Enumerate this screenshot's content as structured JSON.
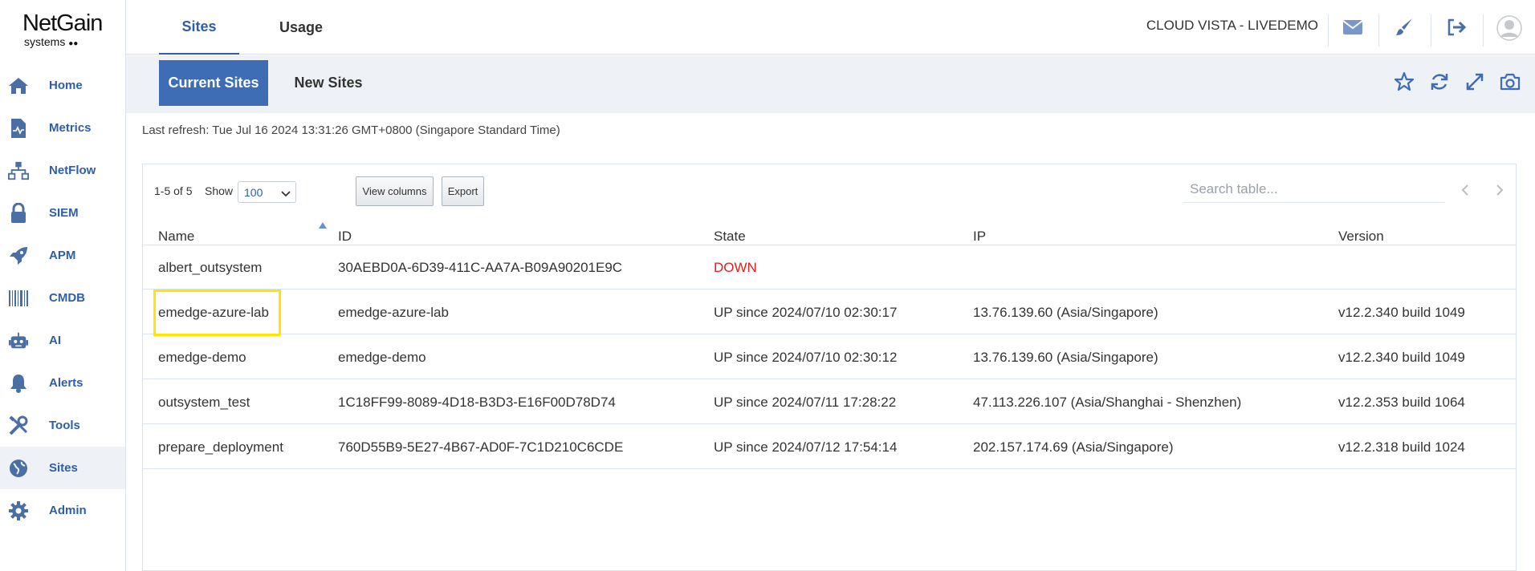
{
  "logo": {
    "main": "NetGain",
    "sub": "systems"
  },
  "sidebar": {
    "items": [
      {
        "label": "Home",
        "icon": "home-icon"
      },
      {
        "label": "Metrics",
        "icon": "metrics-icon"
      },
      {
        "label": "NetFlow",
        "icon": "netflow-icon"
      },
      {
        "label": "SIEM",
        "icon": "lock-icon"
      },
      {
        "label": "APM",
        "icon": "rocket-icon"
      },
      {
        "label": "CMDB",
        "icon": "barcode-icon"
      },
      {
        "label": "AI",
        "icon": "robot-icon"
      },
      {
        "label": "Alerts",
        "icon": "bell-icon"
      },
      {
        "label": "Tools",
        "icon": "tools-icon"
      },
      {
        "label": "Sites",
        "icon": "globe-icon"
      },
      {
        "label": "Admin",
        "icon": "gear-icon"
      }
    ],
    "active": "Sites"
  },
  "topbar": {
    "tabs": [
      {
        "label": "Sites"
      },
      {
        "label": "Usage"
      }
    ],
    "env_name": "CLOUD VISTA - LIVEDEMO",
    "icons": [
      "mail-icon",
      "brush-icon",
      "logout-icon",
      "user-avatar-icon"
    ]
  },
  "subbar": {
    "tabs": [
      {
        "label": "Current Sites"
      },
      {
        "label": "New Sites"
      }
    ],
    "icons": [
      "star-icon",
      "refresh-icon",
      "expand-icon",
      "camera-icon"
    ]
  },
  "refresh_text": "Last refresh: Tue Jul 16 2024 13:31:26 GMT+0800 (Singapore Standard Time)",
  "table": {
    "count_text": "1-5 of 5",
    "show_label": "Show",
    "show_value": "100",
    "view_columns_label": "View columns",
    "export_label": "Export",
    "search_placeholder": "Search table...",
    "columns": [
      "Name",
      "ID",
      "State",
      "IP",
      "Version"
    ],
    "rows": [
      {
        "name": "albert_outsystem",
        "id": "30AEBD0A-6D39-411C-AA7A-B09A90201E9C",
        "state": "DOWN",
        "ip": "",
        "version": ""
      },
      {
        "name": "emedge-azure-lab",
        "id": "emedge-azure-lab",
        "state": "UP since 2024/07/10 02:30:17",
        "ip": "13.76.139.60 (Asia/Singapore)",
        "version": "v12.2.340 build 1049"
      },
      {
        "name": "emedge-demo",
        "id": "emedge-demo",
        "state": "UP since 2024/07/10 02:30:12",
        "ip": "13.76.139.60 (Asia/Singapore)",
        "version": "v12.2.340 build 1049"
      },
      {
        "name": "outsystem_test",
        "id": "1C18FF99-8089-4D18-B3D3-E16F00D78D74",
        "state": "UP since 2024/07/11 17:28:22",
        "ip": "47.113.226.107 (Asia/Shanghai - Shenzhen)",
        "version": "v12.2.353 build 1064"
      },
      {
        "name": "prepare_deployment",
        "id": "760D55B9-5E27-4B67-AD0F-7C1D210C6CDE",
        "state": "UP since 2024/07/12 17:54:14",
        "ip": "202.157.174.69 (Asia/Singapore)",
        "version": "v12.2.318 build 1024"
      }
    ]
  },
  "colors": {
    "accent": "#2f5ea8",
    "active_tab_bg": "#3e6cb5",
    "down": "#e02020",
    "highlight": "#ffe500"
  }
}
